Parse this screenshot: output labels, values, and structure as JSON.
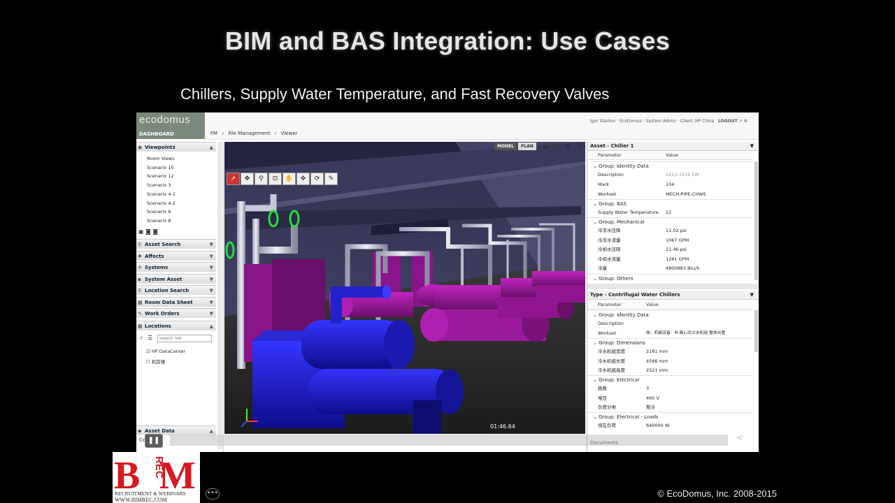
{
  "slide": {
    "title": "BIM and BAS Integration: Use Cases",
    "subtitle": "Chillers, Supply Water Temperature, and Fast Recovery Valves",
    "copyright": "© EcoDomus, Inc. 2008-2015"
  },
  "app": {
    "logo": "ecodomus",
    "dashboard": "DASHBOARD",
    "breadcrumb": [
      "FM",
      "›",
      "File Management",
      "›",
      "Viewer"
    ],
    "user": "Igor Starkov · EcoDomus · System Admin · Client: HP China",
    "logout": "LOGOUT"
  },
  "sidebar": {
    "viewpoints": "Viewpoints",
    "room_views": "Room Views",
    "scenarios": [
      "Scenario 10",
      "Scenario 12",
      "Scenario 3",
      "Scenario 4-1",
      "Scenario 4-2",
      "Scenario 6",
      "Scenario 8"
    ],
    "sections": [
      "Asset Search",
      "Affects",
      "Systems",
      "System Asset",
      "Location Search",
      "Room Data Sheet",
      "Work Orders"
    ],
    "locations": "Locations",
    "search_placeholder": "Search Text",
    "loc_items": [
      "HP DataCenter",
      "机房楼"
    ],
    "asset_data": "Asset Data",
    "comments": "Co"
  },
  "viewer": {
    "mode_model": "MODEL",
    "mode_plan": "PLAN"
  },
  "asset_panel": {
    "title": "Asset - Chiller 1",
    "col_param": "Parameter",
    "col_value": "Value",
    "group_identity": "Group: Identity Data",
    "identity_rows": [
      {
        "k": "Description",
        "v": "2813-3516 kW"
      },
      {
        "k": "Mark",
        "v": "104"
      },
      {
        "k": "Workset",
        "v": "MECH-PIPE-CHWS"
      }
    ],
    "group_bas": "Group: BAS",
    "bas_rows": [
      {
        "k": "Supply Water Temperature",
        "v": "22"
      }
    ],
    "group_mech": "Group: Mechanical",
    "mech_rows": [
      {
        "k": "冷冻水压降",
        "v": "11.02 psi"
      },
      {
        "k": "冷冻水流量",
        "v": "1067 GPM"
      },
      {
        "k": "冷却水压降",
        "v": "11.46 psi"
      },
      {
        "k": "冷却水流量",
        "v": "1281 GPM"
      },
      {
        "k": "冷量",
        "v": "4800883 Btu/h"
      }
    ],
    "group_others": "Group: Others"
  },
  "type_panel": {
    "title": "Type - Centrifugal Water Chillers",
    "col_param": "Parameter",
    "col_value": "Value",
    "group_identity": "Group: Identity Data",
    "identity_rows": [
      {
        "k": "Description",
        "v": ""
      },
      {
        "k": "Workset",
        "v": "族：机械设备：M-离心式冷水机组 整体出管"
      }
    ],
    "group_dims": "Group: Dimensions",
    "dims_rows": [
      {
        "k": "冷水机组宽度",
        "v": "2181 mm"
      },
      {
        "k": "冷水机组长度",
        "v": "4566 mm"
      },
      {
        "k": "冷水机组高度",
        "v": "2521 mm"
      }
    ],
    "group_elec": "Group: Electrical",
    "elec_rows": [
      {
        "k": "极数",
        "v": "3"
      },
      {
        "k": "电压",
        "v": "460 V"
      },
      {
        "k": "负荷分类",
        "v": "制冷"
      }
    ],
    "group_loads": "Group: Electrical - Loads",
    "loads_rows": [
      {
        "k": "视在负荷",
        "v": "640000 W"
      }
    ],
    "footer": "Documents"
  },
  "video": {
    "time": "01:46.64",
    "progress": 0.575
  },
  "brand": {
    "bim_letters": "B M",
    "rec": "REC",
    "tagline1": "RECRUITMENT & WEBINARS",
    "tagline2": "WWW.BIMREC.COM"
  },
  "colors": {
    "magenta": "#9b1a9b",
    "blue": "#1e1ee6",
    "pipe": "#c8c8d8",
    "logo_red": "#d71920"
  }
}
